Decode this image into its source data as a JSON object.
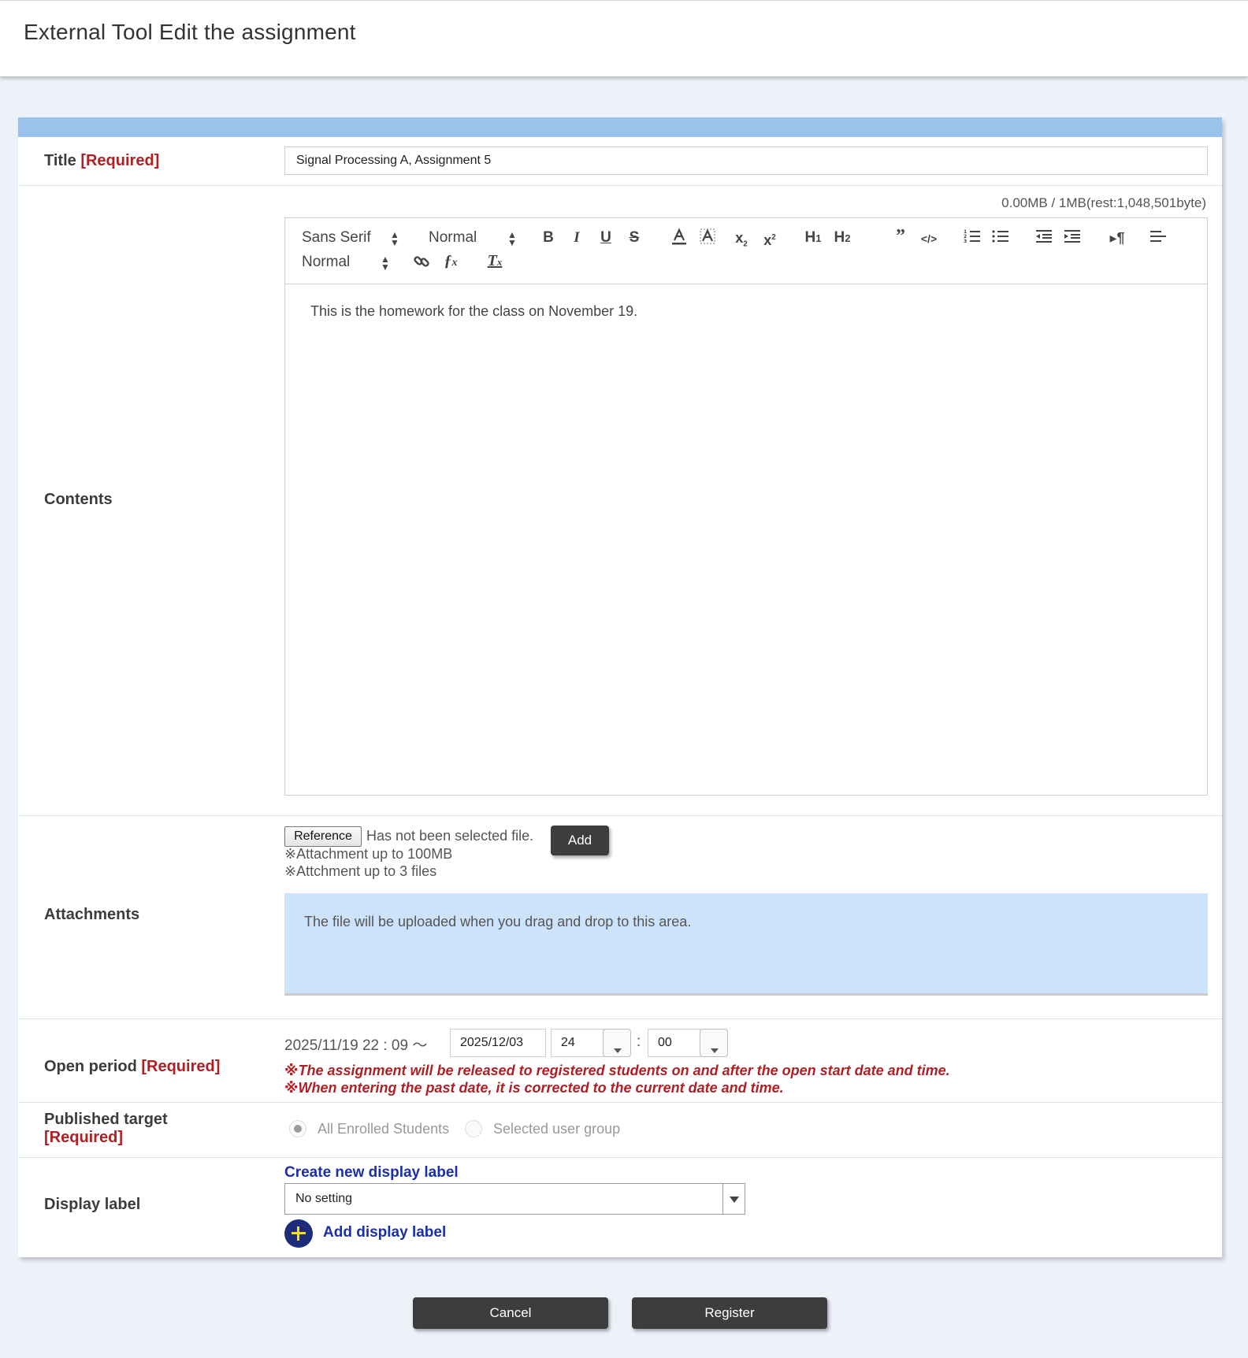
{
  "header": {
    "title": "External Tool Edit the assignment"
  },
  "form": {
    "required_tag": "[Required]",
    "title_row": {
      "label": "Title",
      "value": "Signal Processing A, Assignment 5"
    },
    "contents_row": {
      "label": "Contents",
      "size_info": "0.00MB / 1MB(rest:1,048,501byte)",
      "toolbar": {
        "font_family": "Sans Serif",
        "font_size": "Normal",
        "heading": "Normal",
        "bold": "B",
        "italic": "I",
        "underline": "U",
        "strike": "S",
        "h1": "H1",
        "h2": "H2"
      },
      "body_text": "This is the homework for the class on November 19."
    },
    "attachments_row": {
      "label": "Attachments",
      "reference_button": "Reference",
      "no_file_text": "Has not been selected file.",
      "add_button": "Add",
      "note_size": "※Attachment up to 100MB",
      "note_count": "※Attchment up to 3 files",
      "drop_text": "The file will be uploaded when you drag and drop to this area."
    },
    "open_period_row": {
      "label": "Open period",
      "start": "2025/11/19 22 : 09 ～",
      "end_date": "2025/12/03",
      "end_hour": "24",
      "end_minute": "00",
      "colon": ":",
      "warning1": "※The assignment will be released to registered students on and after the open start date and time.",
      "warning2": "※When entering the past date, it is corrected to the current date and time."
    },
    "published_target_row": {
      "label": "Published target",
      "option_all": "All Enrolled Students",
      "option_group": "Selected user group",
      "selected": "All Enrolled Students"
    },
    "display_label_row": {
      "label": "Display label",
      "create_link": "Create new display label",
      "select_value": "No setting",
      "add_link": "Add display label"
    }
  },
  "footer": {
    "cancel": "Cancel",
    "register": "Register"
  }
}
